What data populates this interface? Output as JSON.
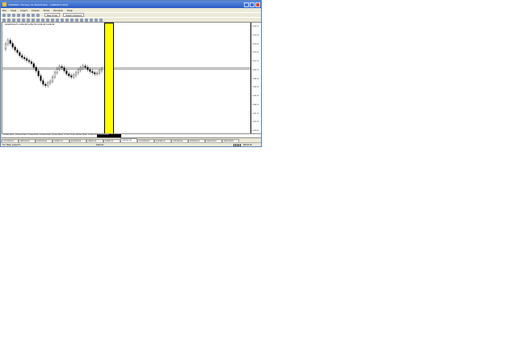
{
  "window": {
    "title": "7080000: Fairway Int MetaTrader - [GBLWCCUSO]",
    "accent": "#2a5cc4"
  },
  "menu": [
    "File",
    "View",
    "Insert",
    "Charts",
    "Tools",
    "Window",
    "Help"
  ],
  "toolbar": {
    "new_order_label": "New Order",
    "expert_advisors_label": "Expert Advisors"
  },
  "chart": {
    "symbol_line": "GOLDM10,H1 1249.48 1250.39 1249.48 1249.89",
    "highlight_color": "#ffff00",
    "price_ticks": [
      "1256.70",
      "1255.30",
      "1253.90",
      "1252.50",
      "1251.10",
      "1249.70",
      "1248.30",
      "1246.90",
      "1245.50",
      "1244.10",
      "1242.70",
      "1241.30",
      "1239.90"
    ],
    "time_labels": [
      "26 Nov 2014",
      "28 Dec 09:00",
      "13 Dec 09:00",
      "13 Dec 09:00",
      "16 Dec 14:00",
      "17 Dec 11:00",
      "18 Dec 15:00",
      "19 Dec 17:00"
    ],
    "selected_time": "22 Dec 03:00"
  },
  "tabs": [
    "GOLDM10,H1",
    "GBPUSD,H1",
    "EURUSD,H4",
    "USDJPY,H1",
    "AUDUSD,H4",
    "GBPJPY,H1",
    "EURJPY,H1",
    "USDCHF,H4",
    "GOLDM10,H1",
    "EURGBP,H1",
    "USDCAD,H4",
    "NZDUSD,H1",
    "XAGUSD,H1",
    "GBPUSD,M1"
  ],
  "active_tab": 7,
  "status": {
    "help_text": "For Help, press F1",
    "profile": "Default",
    "connection": "803/3 kb"
  },
  "chart_data": {
    "type": "candlestick",
    "note": "",
    "x": [
      0,
      1,
      2,
      3,
      4,
      5,
      6,
      7,
      8,
      9,
      10,
      11,
      12,
      13,
      14,
      15,
      16,
      17,
      18,
      19,
      20,
      21,
      22,
      23,
      24,
      25,
      26,
      27,
      28,
      29,
      30,
      31,
      32,
      33,
      34,
      35,
      36,
      37,
      38,
      39,
      40,
      41,
      42,
      43,
      44,
      45,
      46,
      47,
      48,
      49,
      50,
      51,
      52,
      53,
      54,
      55,
      56,
      57,
      58,
      59
    ],
    "open": [
      1253.2,
      1254.0,
      1254.6,
      1254.1,
      1253.5,
      1253.0,
      1252.6,
      1252.1,
      1251.8,
      1251.6,
      1251.3,
      1251.1,
      1250.8,
      1250.2,
      1249.6,
      1248.8,
      1248.0,
      1247.4,
      1247.2,
      1247.6,
      1247.9,
      1248.6,
      1249.3,
      1249.9,
      1250.3,
      1250.1,
      1249.6,
      1249.1,
      1248.8,
      1248.6,
      1248.9,
      1249.3,
      1249.7,
      1250.1,
      1250.4,
      1250.2,
      1249.8,
      1249.5,
      1249.3,
      1249.1,
      1249.2,
      1249.6
    ],
    "close": [
      1254.0,
      1254.6,
      1254.1,
      1253.5,
      1253.0,
      1252.6,
      1252.1,
      1251.8,
      1251.6,
      1251.3,
      1251.1,
      1250.8,
      1250.2,
      1249.6,
      1248.8,
      1248.0,
      1247.4,
      1247.2,
      1247.6,
      1247.9,
      1248.6,
      1249.3,
      1249.9,
      1250.3,
      1250.1,
      1249.6,
      1249.1,
      1248.8,
      1248.6,
      1248.9,
      1249.3,
      1249.7,
      1250.1,
      1250.4,
      1250.2,
      1249.8,
      1249.5,
      1249.3,
      1249.1,
      1249.2,
      1249.6,
      1249.9
    ],
    "horizontal_lines": [
      1250.1,
      1249.9
    ],
    "ylim": [
      1239.9,
      1256.7
    ]
  }
}
